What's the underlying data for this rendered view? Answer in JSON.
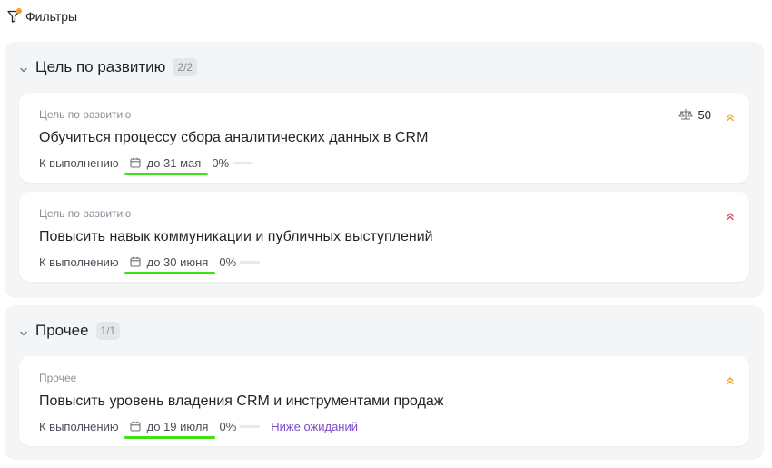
{
  "filters": {
    "label": "Фильтры"
  },
  "colors": {
    "accent": "#7c4dcc",
    "priority_medium": "#f0a020",
    "priority_high": "#e0405a",
    "highlight": "#3fe014"
  },
  "groups": [
    {
      "title": "Цель по развитию",
      "count": "2/2",
      "cards": [
        {
          "type": "Цель по развитию",
          "title": "Обучиться процессу сбора аналитических данных в CRM",
          "status": "К выполнению",
          "deadline": "до 31 мая",
          "progress_text": "0%",
          "progress": 0,
          "score": "50",
          "score_icon": "scale-icon",
          "priority_icon": "priority-medium-icon"
        },
        {
          "type": "Цель по развитию",
          "title": "Повысить навык коммуникации и публичных выступлений",
          "status": "К выполнению",
          "deadline": "до 30 июня",
          "progress_text": "0%",
          "progress": 0,
          "priority_icon": "priority-high-icon"
        }
      ]
    },
    {
      "title": "Прочее",
      "count": "1/1",
      "cards": [
        {
          "type": "Прочее",
          "title": "Повысить уровень владения CRM и инструментами продаж",
          "status": "К выполнению",
          "deadline": "до 19 июля",
          "progress_text": "0%",
          "progress": 0,
          "note": "Ниже ожиданий",
          "priority_icon": "priority-medium-icon"
        }
      ]
    }
  ]
}
